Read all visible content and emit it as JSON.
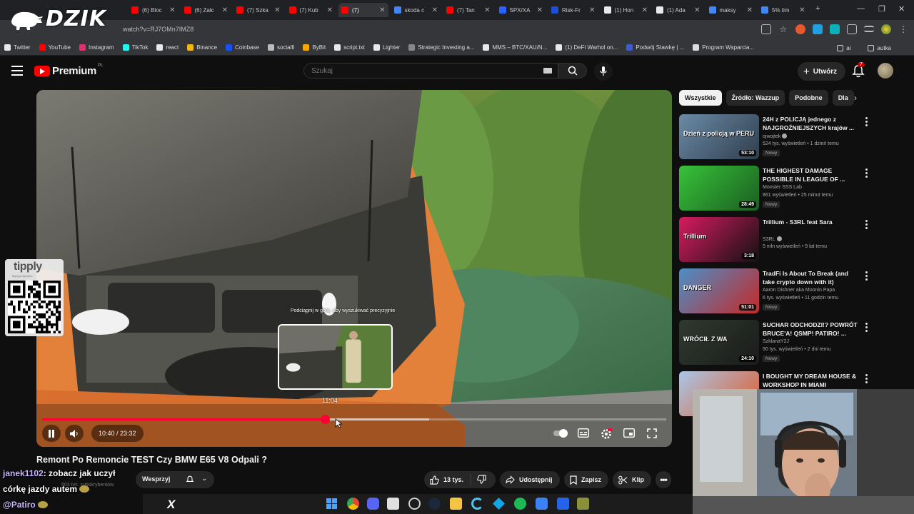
{
  "stream_overlay": {
    "logo_text": "DZIK",
    "tipply_text": "tipply",
    "tipply_sub": "tipply.pl/@patiro",
    "chat": [
      {
        "user": "janek1102",
        "message": ": zobacz jak uczył"
      },
      {
        "user": "",
        "message": "córkę jazdy autem"
      },
      {
        "user": "@Patiro",
        "message": ""
      }
    ]
  },
  "browser": {
    "tabs": [
      {
        "label": "(6) Bloc",
        "color": "#ff0000"
      },
      {
        "label": "(6) Załc",
        "color": "#ff0000"
      },
      {
        "label": "(7) Szka",
        "color": "#ff0000"
      },
      {
        "label": "(7) Kub",
        "color": "#ff0000"
      },
      {
        "label": "(7)",
        "color": "#ff0000"
      },
      {
        "label": "skoda c",
        "color": "#4285f4"
      },
      {
        "label": "(7) Tan",
        "color": "#ff0000"
      },
      {
        "label": "SPX/XA",
        "color": "#2962ff"
      },
      {
        "label": "Risk-Fr",
        "color": "#1d4ed8"
      },
      {
        "label": "(1) Hon",
        "color": "#e7e9ea"
      },
      {
        "label": "(1) Ada",
        "color": "#e7e9ea"
      },
      {
        "label": "maksy",
        "color": "#4285f4"
      },
      {
        "label": "5% tim",
        "color": "#4285f4"
      }
    ],
    "new_tab_label": "+",
    "url": "watch?v=RJ7OMn7IMZ8",
    "bookmarks": [
      {
        "label": "Twitter",
        "color": "#e7e9ea"
      },
      {
        "label": "YouTube",
        "color": "#ff0000"
      },
      {
        "label": "Instagram",
        "color": "#e1306c"
      },
      {
        "label": "TikTok",
        "color": "#25f4ee"
      },
      {
        "label": "react",
        "color": "#e7e9ea"
      },
      {
        "label": "Binance",
        "color": "#f0b90b"
      },
      {
        "label": "Coinbase",
        "color": "#1652f0"
      },
      {
        "label": "socialfi",
        "color": "#bbbbbb"
      },
      {
        "label": "ByBit",
        "color": "#f7a600"
      },
      {
        "label": "script.txt",
        "color": "#e7e9ea"
      },
      {
        "label": "Lighter",
        "color": "#e7e9ea"
      },
      {
        "label": "Strategic Investing a...",
        "color": "#888888"
      },
      {
        "label": "MMS – BTC/XAU/N...",
        "color": "#e7e9ea"
      },
      {
        "label": "(1) DeFi Warhol on...",
        "color": "#e7e9ea"
      },
      {
        "label": "Podwój Stawkę | ...",
        "color": "#3b5bdb"
      },
      {
        "label": "Program Wsparcia...",
        "color": "#dddddd"
      }
    ],
    "bookmark_folders": [
      "ai",
      "autka"
    ]
  },
  "youtube": {
    "logo": "Premium",
    "country": "PL",
    "search_placeholder": "Szukaj",
    "create_label": "Utwórz",
    "notif_count": "7"
  },
  "player": {
    "current_time": "10:40",
    "duration": "23:32",
    "time_display": "10:40 / 23:32",
    "hover_time": "11:04",
    "played_fraction": 0.453,
    "buffered_fraction": 0.62,
    "hint": "Podciągnij w górę, aby wyszukiwać precyzyjnie"
  },
  "video": {
    "title": "Remont Po Remoncie TEST Czy BMW E65 V8 Odpali ?",
    "subscribers": "603 tys. subskrybentów",
    "support_label": "Wesprzyj",
    "likes": "13 tys.",
    "share_label": "Udostępnij",
    "save_label": "Zapisz",
    "clip_label": "Klip"
  },
  "chips": [
    {
      "label": "Wszystkie",
      "active": true
    },
    {
      "label": "Źródło: Wazzup",
      "active": false
    },
    {
      "label": "Podobne",
      "active": false
    },
    {
      "label": "Dla",
      "active": false
    }
  ],
  "recommendations": [
    {
      "title": "24H z POLICJĄ jednego z NAJGROŹNIEJSZYCH krajów ...",
      "channel": "ojwojtek",
      "verified": true,
      "meta": "524 tys. wyświetleń • 1 dzień temu",
      "badge": "Nowy",
      "duration": "53:10",
      "thumb_text": "Dzień z policją w PERU",
      "colors": [
        "#6b8aa6",
        "#2f3e4d"
      ]
    },
    {
      "title": "THE HIGHEST DAMAGE POSSIBLE IN LEAGUE OF ...",
      "channel": "Monster SSS Lab",
      "verified": false,
      "meta": "861 wyświetleń • 25 minut temu",
      "badge": "Nowy",
      "duration": "28:49",
      "thumb_text": "",
      "colors": [
        "#37c23a",
        "#1b5e20"
      ]
    },
    {
      "title": "Trillium - S3RL feat Sara",
      "channel": "S3RL",
      "verified": true,
      "meta": "5 mln wyświetleń • 9 lat temu",
      "badge": "",
      "duration": "3:18",
      "thumb_text": "Trillium",
      "colors": [
        "#d81b60",
        "#111111"
      ]
    },
    {
      "title": "TradFi Is About To Break (and take crypto down with it)",
      "channel": "Aaron Dishner aka Moonin Papa",
      "verified": false,
      "meta": "6 tys. wyświetleń • 11 godzin temu",
      "badge": "Nowy",
      "duration": "51:01",
      "thumb_text": "DANGER",
      "colors": [
        "#4a90c8",
        "#c62828"
      ]
    },
    {
      "title": "SUCHAR ODCHODZI!? POWRÓT BRUCE'A! QSMP! PATIRO! ...",
      "channel": "SzklanaY2J",
      "verified": false,
      "meta": "90 tys. wyświetleń • 2 dni temu",
      "badge": "Nowy",
      "duration": "24:10",
      "thumb_text": "WRÓCIŁ Z WA",
      "colors": [
        "#2e3a2f",
        "#1b1b1b"
      ]
    },
    {
      "title": "I BOUGHT MY DREAM HOUSE & WORKSHOP IN MIAMI",
      "channel": "",
      "verified": false,
      "meta": "",
      "badge": "",
      "duration": "",
      "thumb_text": "",
      "colors": [
        "#a9c7e8",
        "#e05a2b"
      ]
    }
  ]
}
